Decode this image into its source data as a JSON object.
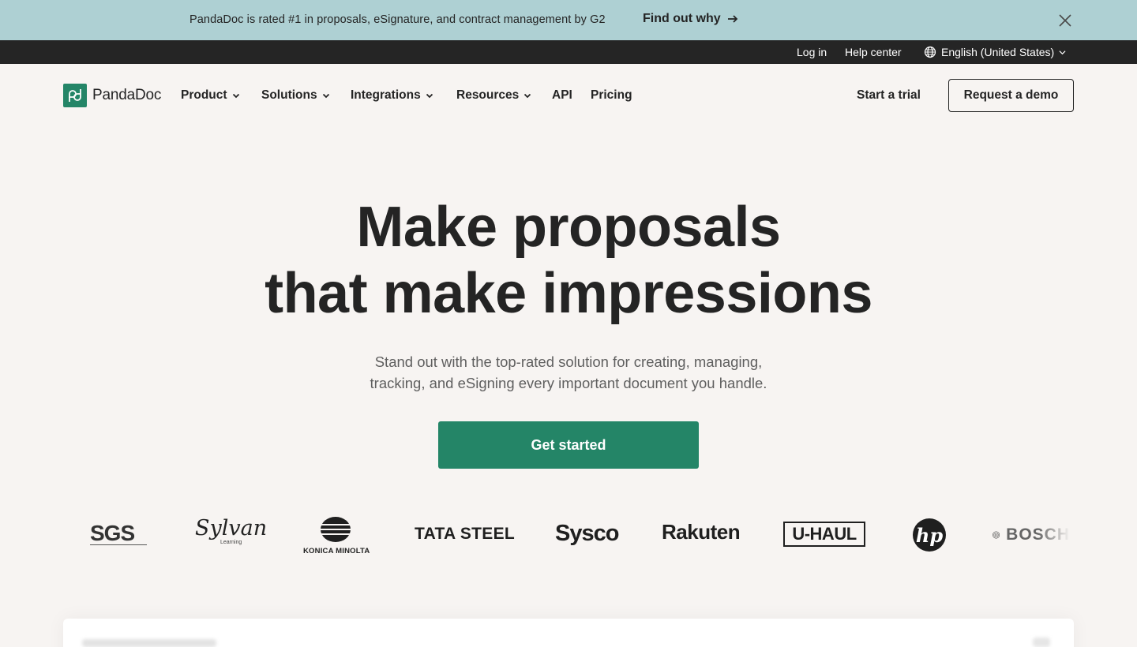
{
  "promo": {
    "text": "PandaDoc is rated #1 in proposals, eSignature, and contract management by G2",
    "link_label": "Find out why"
  },
  "utility": {
    "login": "Log in",
    "help": "Help center",
    "language": "English (United States)"
  },
  "header": {
    "brand": "PandaDoc",
    "nav": [
      "Product",
      "Solutions",
      "Integrations",
      "Resources",
      "API",
      "Pricing"
    ],
    "trial": "Start a trial",
    "demo": "Request a demo"
  },
  "hero": {
    "title_line1": "Make proposals",
    "title_line2": "that make impressions",
    "subtitle_line1": "Stand out with the top-rated solution for creating, managing,",
    "subtitle_line2": "tracking, and eSigning every important document you handle.",
    "cta": "Get started"
  },
  "customers": {
    "logos": [
      "SGS",
      "Sylvan",
      "Learning",
      "KONICA MINOLTA",
      "TATA STEEL",
      "Sysco",
      "Rakuten",
      "U-HAUL",
      "hp",
      "BOSCH"
    ]
  },
  "colors": {
    "brand_green": "#248567",
    "banner": "#aed0d3",
    "utility_bar": "#252525",
    "page_bg": "#f7f4f2"
  }
}
